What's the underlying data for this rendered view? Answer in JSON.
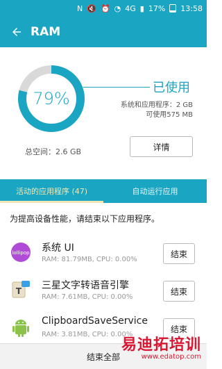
{
  "status_bar": {
    "time": "13:58",
    "battery_percent": "17%",
    "icons": [
      "nfc-icon",
      "mute-icon",
      "alarm-icon",
      "wifi-icon",
      "signal-4g-icon",
      "signal-icon",
      "battery-icon"
    ],
    "network_label": "4G"
  },
  "app_bar": {
    "title": "RAM",
    "back_icon": "back-arrow-icon"
  },
  "memory": {
    "used_percent": 79,
    "percent_label": "79%",
    "used_title": "已使用",
    "system_and_apps": "系统和应用程序：2 GB",
    "available": "可使用575 MB",
    "total_space": "总空间：2.6 GB",
    "details_label": "详情"
  },
  "tabs": [
    {
      "label": "活动的应用程序 (47)",
      "active": true
    },
    {
      "label": "自动运行应用",
      "active": false
    }
  ],
  "prompt": "为提高设备性能，请结束以下应用程序。",
  "apps": [
    {
      "name": "系统 UI",
      "meta": "RAM: 81.79MB, CPU: 0.00%",
      "icon": "lollipop-icon",
      "icon_text": "lollipop",
      "end_label": "结束"
    },
    {
      "name": "三星文字转语音引擎",
      "meta": "RAM: 7.61MB, CPU: 0.00%",
      "icon": "text-to-speech-icon",
      "end_label": "结束"
    },
    {
      "name": "ClipboardSaveService",
      "meta": "RAM: 3.81MB, CPU: 0.00%",
      "icon": "android-icon",
      "end_label": "结束"
    }
  ],
  "bottom_bar": {
    "end_all_label": "结束全部"
  },
  "watermark": {
    "text": "易迪拓培训",
    "url": "www.edatop.com"
  },
  "colors": {
    "primary": "#1aa5c2",
    "tab_active": "#f2e8b5",
    "ring_track": "#d9d9d9",
    "watermark": "#d8001f"
  }
}
